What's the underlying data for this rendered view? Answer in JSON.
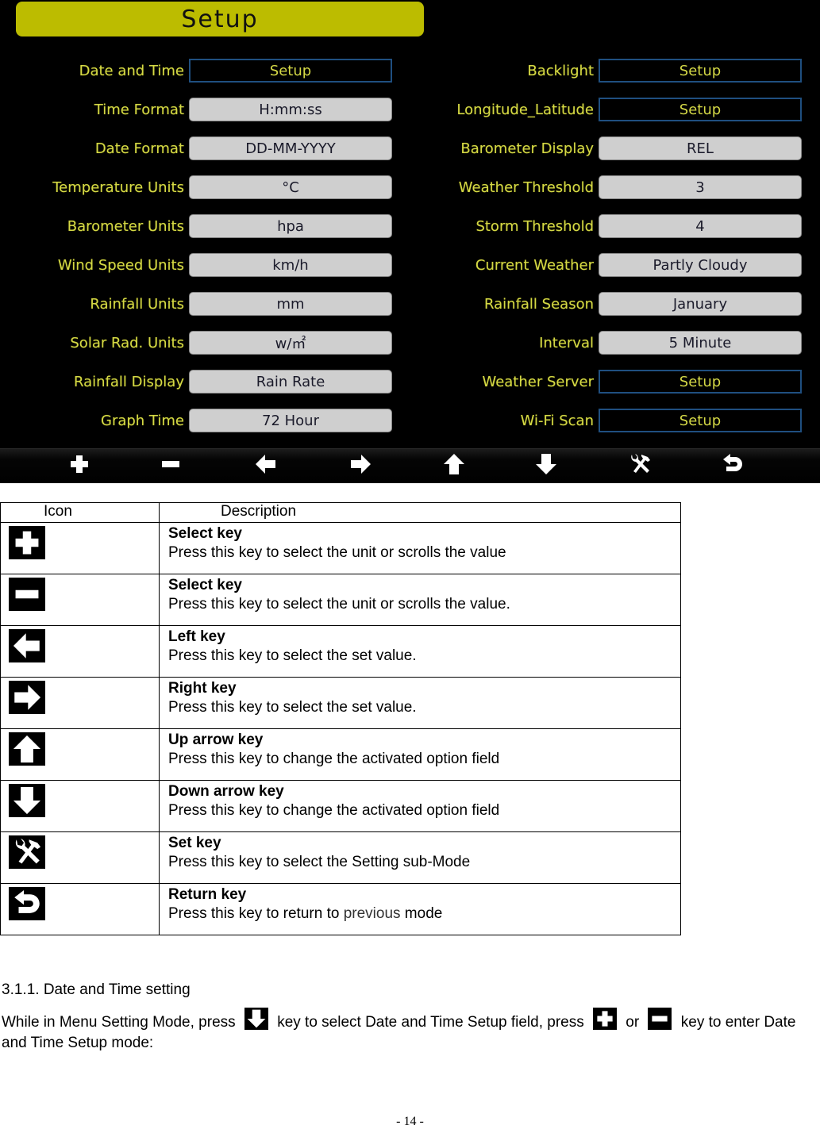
{
  "device": {
    "title": "Setup",
    "colors": {
      "label": "#d4d846",
      "title_bar": "#bcbc00",
      "field_bg": "#cfcfcf",
      "setup_border": "#1f4f80"
    },
    "left_settings": [
      {
        "label": "Date and Time",
        "value": "Setup",
        "kind": "setup"
      },
      {
        "label": "Time Format",
        "value": "H:mm:ss",
        "kind": "field"
      },
      {
        "label": "Date Format",
        "value": "DD-MM-YYYY",
        "kind": "field"
      },
      {
        "label": "Temperature Units",
        "value": "°C",
        "kind": "field"
      },
      {
        "label": "Barometer Units",
        "value": "hpa",
        "kind": "field"
      },
      {
        "label": "Wind Speed Units",
        "value": "km/h",
        "kind": "field"
      },
      {
        "label": "Rainfall Units",
        "value": "mm",
        "kind": "field"
      },
      {
        "label": "Solar Rad. Units",
        "value": "w/㎡",
        "kind": "field"
      },
      {
        "label": "Rainfall Display",
        "value": "Rain Rate",
        "kind": "field"
      },
      {
        "label": "Graph  Time",
        "value": "72 Hour",
        "kind": "field"
      }
    ],
    "right_settings": [
      {
        "label": "Backlight",
        "value": "Setup",
        "kind": "setup"
      },
      {
        "label": "Longitude_Latitude",
        "value": "Setup",
        "kind": "setup"
      },
      {
        "label": "Barometer Display",
        "value": "REL",
        "kind": "field"
      },
      {
        "label": "Weather Threshold",
        "value": "3",
        "kind": "field"
      },
      {
        "label": "Storm Threshold",
        "value": "4",
        "kind": "field"
      },
      {
        "label": "Current Weather",
        "value": "Partly Cloudy",
        "kind": "field"
      },
      {
        "label": "Rainfall Season",
        "value": "January",
        "kind": "field"
      },
      {
        "label": "Interval",
        "value": "5 Minute",
        "kind": "field"
      },
      {
        "label": "Weather Server",
        "value": "Setup",
        "kind": "setup"
      },
      {
        "label": "Wi-Fi Scan",
        "value": "Setup",
        "kind": "setup"
      }
    ],
    "toolbar": [
      "plus-icon",
      "minus-icon",
      "arrow-left-icon",
      "arrow-right-icon",
      "arrow-up-icon",
      "arrow-down-icon",
      "tools-icon",
      "return-icon"
    ]
  },
  "table": {
    "headers": {
      "icon": "Icon",
      "description": "Description"
    },
    "rows": [
      {
        "icon": "plus-icon",
        "title": "Select key",
        "text": "Press this key to select the unit or scrolls the value"
      },
      {
        "icon": "minus-icon",
        "title": "Select key",
        "text": "Press this key to select the unit or scrolls the value."
      },
      {
        "icon": "arrow-left-icon",
        "title": "Left key",
        "text": "Press this key to select the set value."
      },
      {
        "icon": "arrow-right-icon",
        "title": "Right key",
        "text": "Press this key to select the set value."
      },
      {
        "icon": "arrow-up-icon",
        "title": "Up arrow key",
        "text": "Press this key to change the activated option field"
      },
      {
        "icon": "arrow-down-icon",
        "title": "Down arrow key",
        "text": "Press this key to change the activated option field"
      },
      {
        "icon": "tools-icon",
        "title": "Set key",
        "text": "Press this key to select the Setting sub-Mode"
      },
      {
        "icon": "return-icon",
        "title": "Return key",
        "text_before": "Press this key to return to ",
        "text_highlight": "previous",
        "text_after": " mode"
      }
    ]
  },
  "section": {
    "heading": "3.1.1. Date and Time setting",
    "para_1": "While in Menu Setting Mode, press",
    "para_2": "key to select Date and Time Setup field, press",
    "para_3": "or",
    "para_4": "key to enter Date and Time Setup mode:"
  },
  "page_number": "- 14 -"
}
